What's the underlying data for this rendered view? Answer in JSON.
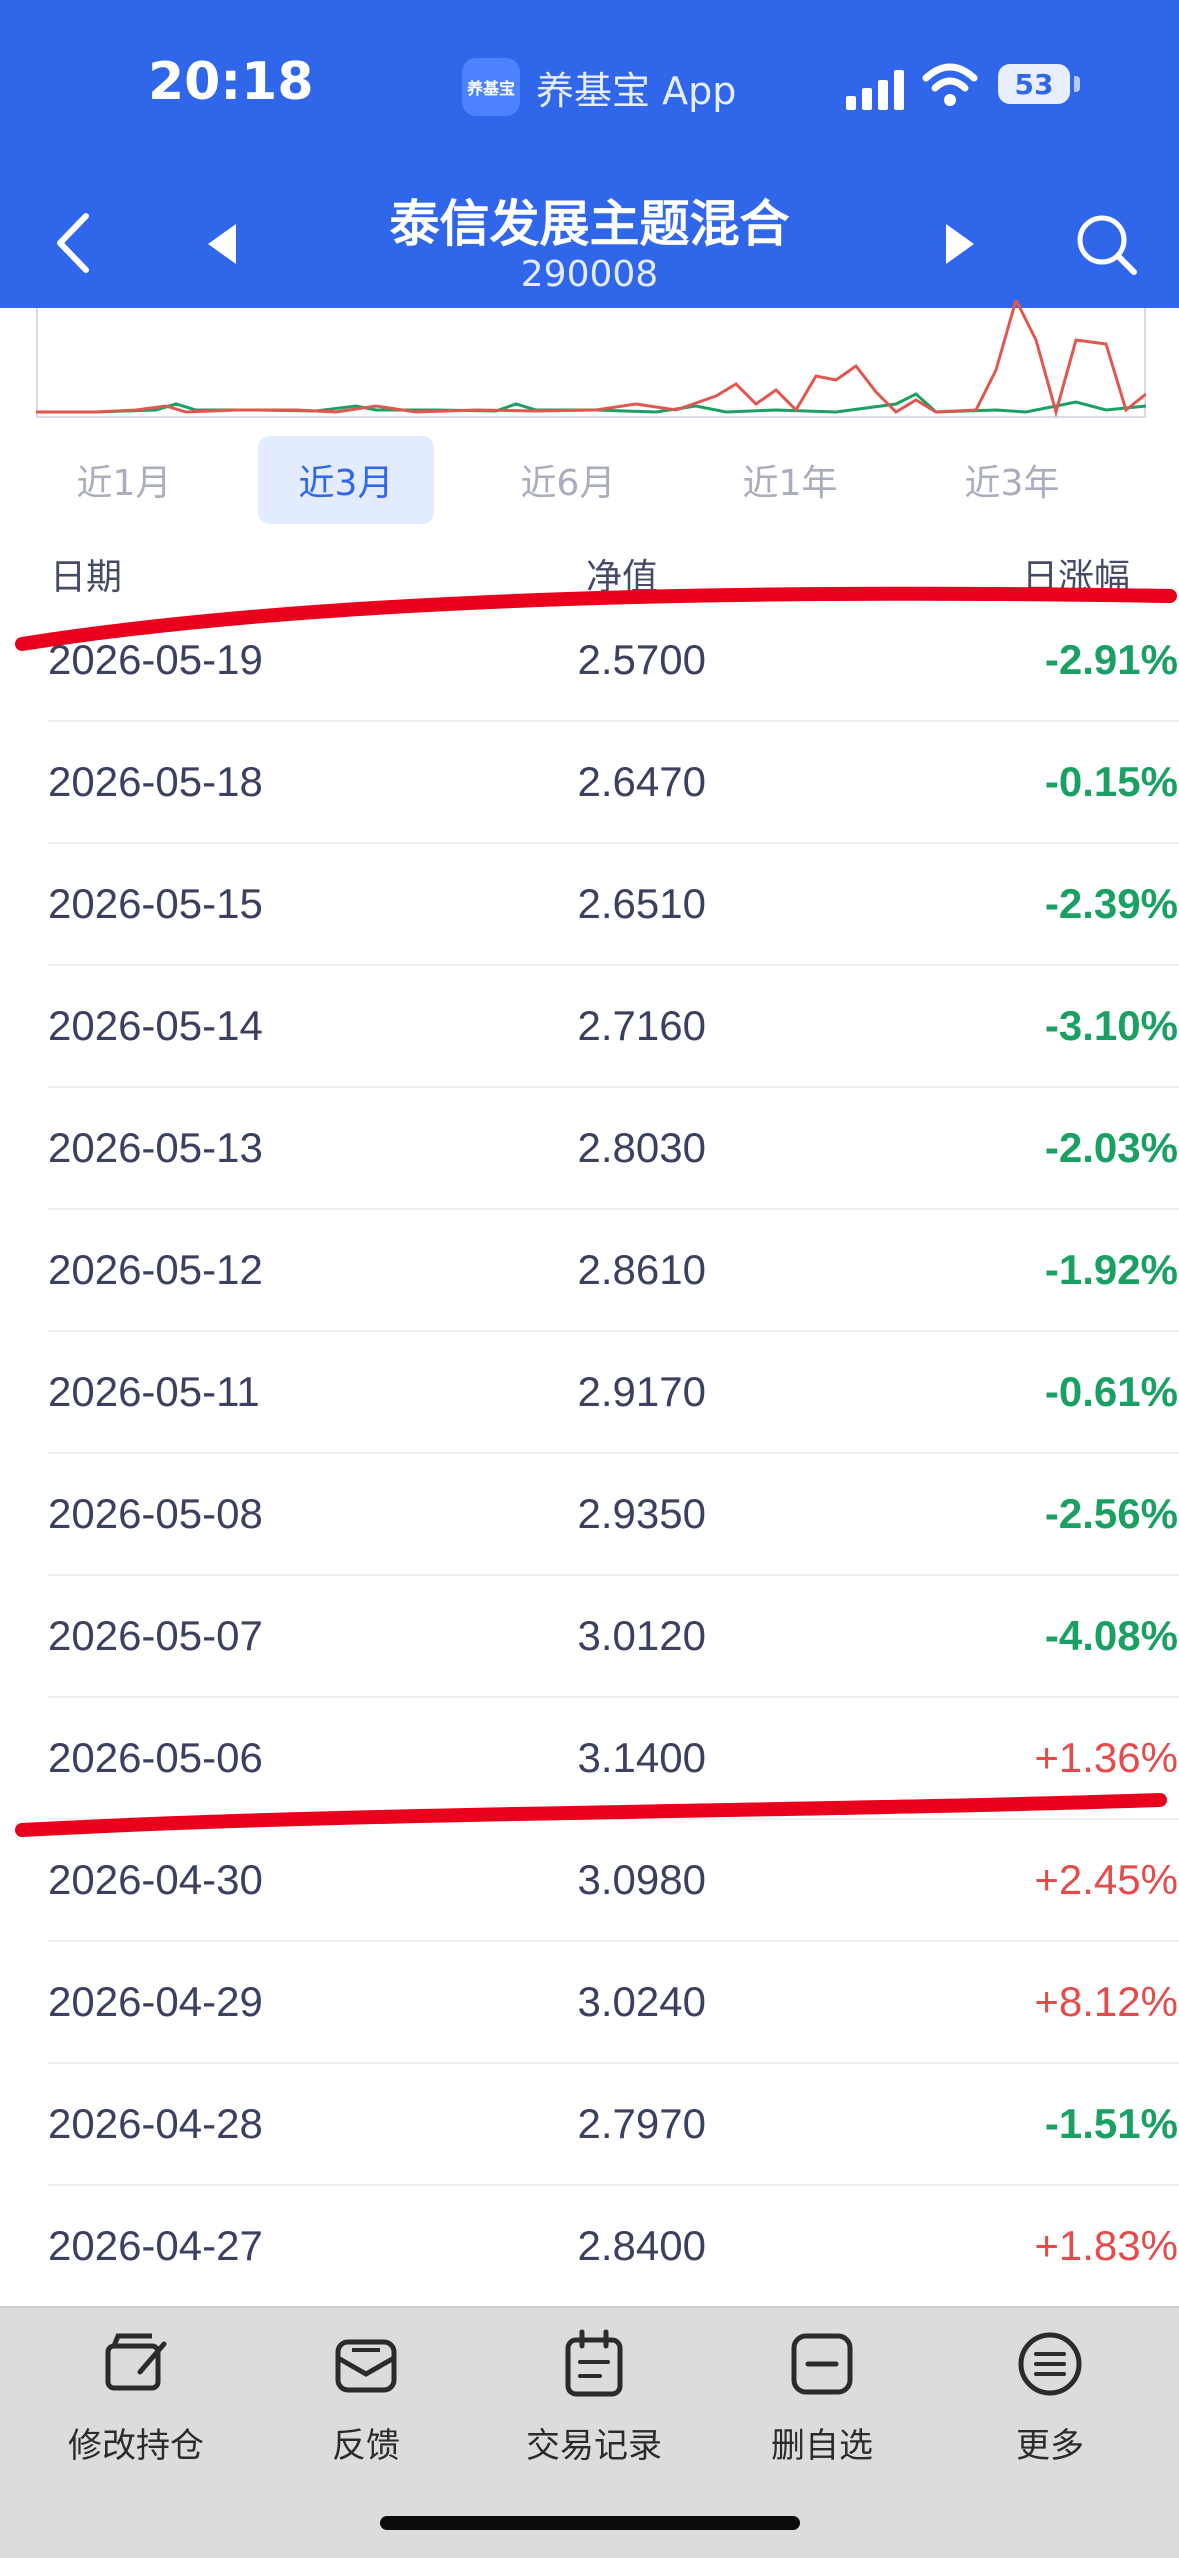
{
  "status_bar": {
    "time": "20:18",
    "app_name": "养基宝 App",
    "app_logo": "养基宝",
    "battery": "53"
  },
  "header": {
    "title": "泰信发展主题混合",
    "code": "290008"
  },
  "colors": {
    "brand": "#2f66ea",
    "down": "#1aa062",
    "up": "#e64b4b",
    "annotation": "#e8001c"
  },
  "tabs": [
    {
      "label": "近1月",
      "active": false
    },
    {
      "label": "近3月",
      "active": true
    },
    {
      "label": "近6月",
      "active": false
    },
    {
      "label": "近1年",
      "active": false
    },
    {
      "label": "近3年",
      "active": false
    }
  ],
  "table": {
    "headers": {
      "date": "日期",
      "nav": "净值",
      "change": "日涨幅"
    },
    "rows": [
      {
        "date": "2026-05-19",
        "nav": "2.5700",
        "change": "-2.91%"
      },
      {
        "date": "2026-05-18",
        "nav": "2.6470",
        "change": "-0.15%"
      },
      {
        "date": "2026-05-15",
        "nav": "2.6510",
        "change": "-2.39%"
      },
      {
        "date": "2026-05-14",
        "nav": "2.7160",
        "change": "-3.10%"
      },
      {
        "date": "2026-05-13",
        "nav": "2.8030",
        "change": "-2.03%"
      },
      {
        "date": "2026-05-12",
        "nav": "2.8610",
        "change": "-1.92%"
      },
      {
        "date": "2026-05-11",
        "nav": "2.9170",
        "change": "-0.61%"
      },
      {
        "date": "2026-05-08",
        "nav": "2.9350",
        "change": "-2.56%"
      },
      {
        "date": "2026-05-07",
        "nav": "3.0120",
        "change": "-4.08%"
      },
      {
        "date": "2026-05-06",
        "nav": "3.1400",
        "change": "+1.36%"
      },
      {
        "date": "2026-04-30",
        "nav": "3.0980",
        "change": "+2.45%"
      },
      {
        "date": "2026-04-29",
        "nav": "3.0240",
        "change": "+8.12%"
      },
      {
        "date": "2026-04-28",
        "nav": "2.7970",
        "change": "-1.51%"
      },
      {
        "date": "2026-04-27",
        "nav": "2.8400",
        "change": "+1.83%"
      }
    ]
  },
  "bottom_bar": [
    {
      "label": "修改持仓",
      "icon": "edit-holdings-icon"
    },
    {
      "label": "反馈",
      "icon": "feedback-mail-icon"
    },
    {
      "label": "交易记录",
      "icon": "calendar-icon"
    },
    {
      "label": "删自选",
      "icon": "remove-favorite-icon"
    },
    {
      "label": "更多",
      "icon": "more-menu-icon"
    }
  ]
}
